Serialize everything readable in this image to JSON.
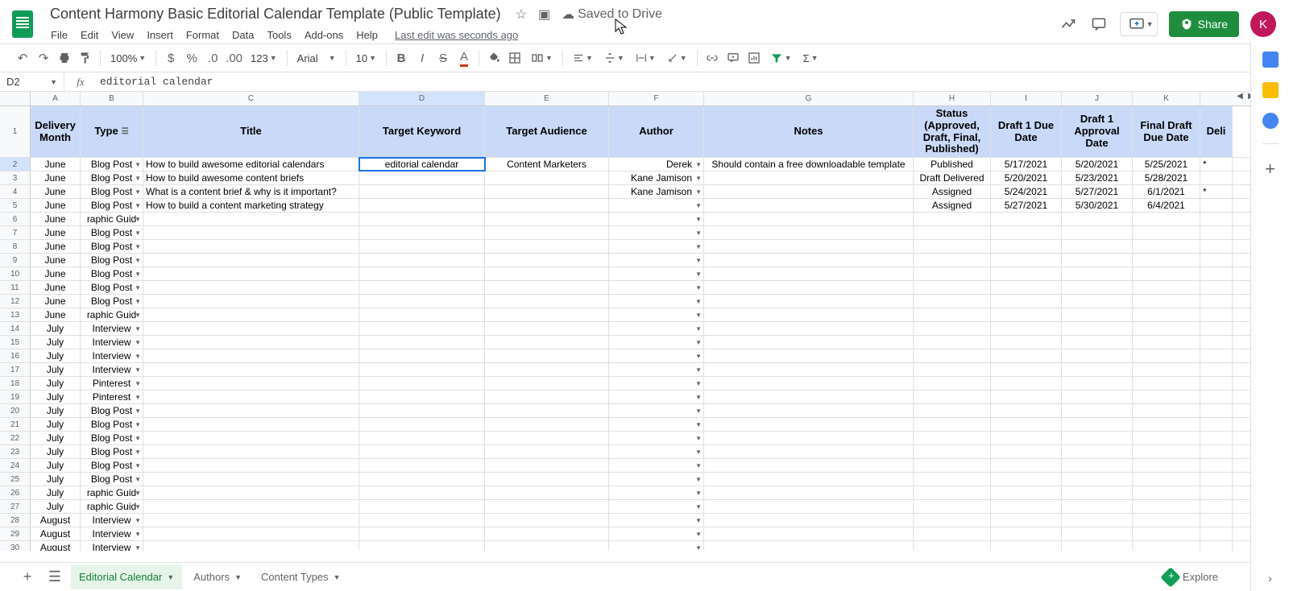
{
  "doc_title": "Content Harmony Basic Editorial Calendar Template (Public Template)",
  "saved_text": "Saved to Drive",
  "menus": [
    "File",
    "Edit",
    "View",
    "Insert",
    "Format",
    "Data",
    "Tools",
    "Add-ons",
    "Help"
  ],
  "last_edit": "Last edit was seconds ago",
  "share_label": "Share",
  "avatar_letter": "K",
  "toolbar": {
    "zoom": "100%",
    "num_fmt": "123",
    "font": "Arial",
    "font_size": "10"
  },
  "name_box": "D2",
  "formula": "editorial calendar",
  "col_letters": [
    "A",
    "B",
    "C",
    "D",
    "E",
    "F",
    "G",
    "H",
    "I",
    "J",
    "K"
  ],
  "headers": [
    "Delivery Month",
    "Type",
    "Title",
    "Target Keyword",
    "Target Audience",
    "Author",
    "Notes",
    "Status (Approved, Draft, Final, Published)",
    "Draft 1 Due Date",
    "Draft 1 Approval Date",
    "Final Draft Due Date",
    "Deli"
  ],
  "rows": [
    {
      "n": 2,
      "a": "June",
      "b": "Blog Post",
      "c": "How to build awesome editorial calendars",
      "d": "editorial calendar",
      "e": "Content Marketers",
      "f": "Derek",
      "g": "Should contain a free downloadable template",
      "h": "Published",
      "i": "5/17/2021",
      "j": "5/20/2021",
      "k": "5/25/2021",
      "l": "*"
    },
    {
      "n": 3,
      "a": "June",
      "b": "Blog Post",
      "c": "How to build awesome content briefs",
      "d": "",
      "e": "",
      "f": "Kane Jamison",
      "g": "",
      "h": "Draft Delivered",
      "i": "5/20/2021",
      "j": "5/23/2021",
      "k": "5/28/2021",
      "l": ""
    },
    {
      "n": 4,
      "a": "June",
      "b": "Blog Post",
      "c": "What is a content brief & why is it important?",
      "d": "",
      "e": "",
      "f": "Kane Jamison",
      "g": "",
      "h": "Assigned",
      "i": "5/24/2021",
      "j": "5/27/2021",
      "k": "6/1/2021",
      "l": "*"
    },
    {
      "n": 5,
      "a": "June",
      "b": "Blog Post",
      "c": "How to build a content marketing strategy",
      "d": "",
      "e": "",
      "f": "",
      "g": "",
      "h": "Assigned",
      "i": "5/27/2021",
      "j": "5/30/2021",
      "k": "6/4/2021",
      "l": ""
    },
    {
      "n": 6,
      "a": "June",
      "b": "raphic Guid",
      "c": "",
      "d": "",
      "e": "",
      "f": "",
      "g": "",
      "h": "",
      "i": "",
      "j": "",
      "k": "",
      "l": ""
    },
    {
      "n": 7,
      "a": "June",
      "b": "Blog Post",
      "c": "",
      "d": "",
      "e": "",
      "f": "",
      "g": "",
      "h": "",
      "i": "",
      "j": "",
      "k": "",
      "l": ""
    },
    {
      "n": 8,
      "a": "June",
      "b": "Blog Post",
      "c": "",
      "d": "",
      "e": "",
      "f": "",
      "g": "",
      "h": "",
      "i": "",
      "j": "",
      "k": "",
      "l": ""
    },
    {
      "n": 9,
      "a": "June",
      "b": "Blog Post",
      "c": "",
      "d": "",
      "e": "",
      "f": "",
      "g": "",
      "h": "",
      "i": "",
      "j": "",
      "k": "",
      "l": ""
    },
    {
      "n": 10,
      "a": "June",
      "b": "Blog Post",
      "c": "",
      "d": "",
      "e": "",
      "f": "",
      "g": "",
      "h": "",
      "i": "",
      "j": "",
      "k": "",
      "l": ""
    },
    {
      "n": 11,
      "a": "June",
      "b": "Blog Post",
      "c": "",
      "d": "",
      "e": "",
      "f": "",
      "g": "",
      "h": "",
      "i": "",
      "j": "",
      "k": "",
      "l": ""
    },
    {
      "n": 12,
      "a": "June",
      "b": "Blog Post",
      "c": "",
      "d": "",
      "e": "",
      "f": "",
      "g": "",
      "h": "",
      "i": "",
      "j": "",
      "k": "",
      "l": ""
    },
    {
      "n": 13,
      "a": "June",
      "b": "raphic Guid",
      "c": "",
      "d": "",
      "e": "",
      "f": "",
      "g": "",
      "h": "",
      "i": "",
      "j": "",
      "k": "",
      "l": ""
    },
    {
      "n": 14,
      "a": "July",
      "b": "Interview",
      "c": "",
      "d": "",
      "e": "",
      "f": "",
      "g": "",
      "h": "",
      "i": "",
      "j": "",
      "k": "",
      "l": ""
    },
    {
      "n": 15,
      "a": "July",
      "b": "Interview",
      "c": "",
      "d": "",
      "e": "",
      "f": "",
      "g": "",
      "h": "",
      "i": "",
      "j": "",
      "k": "",
      "l": ""
    },
    {
      "n": 16,
      "a": "July",
      "b": "Interview",
      "c": "",
      "d": "",
      "e": "",
      "f": "",
      "g": "",
      "h": "",
      "i": "",
      "j": "",
      "k": "",
      "l": ""
    },
    {
      "n": 17,
      "a": "July",
      "b": "Interview",
      "c": "",
      "d": "",
      "e": "",
      "f": "",
      "g": "",
      "h": "",
      "i": "",
      "j": "",
      "k": "",
      "l": ""
    },
    {
      "n": 18,
      "a": "July",
      "b": "Pinterest",
      "c": "",
      "d": "",
      "e": "",
      "f": "",
      "g": "",
      "h": "",
      "i": "",
      "j": "",
      "k": "",
      "l": ""
    },
    {
      "n": 19,
      "a": "July",
      "b": "Pinterest",
      "c": "",
      "d": "",
      "e": "",
      "f": "",
      "g": "",
      "h": "",
      "i": "",
      "j": "",
      "k": "",
      "l": ""
    },
    {
      "n": 20,
      "a": "July",
      "b": "Blog Post",
      "c": "",
      "d": "",
      "e": "",
      "f": "",
      "g": "",
      "h": "",
      "i": "",
      "j": "",
      "k": "",
      "l": ""
    },
    {
      "n": 21,
      "a": "July",
      "b": "Blog Post",
      "c": "",
      "d": "",
      "e": "",
      "f": "",
      "g": "",
      "h": "",
      "i": "",
      "j": "",
      "k": "",
      "l": ""
    },
    {
      "n": 22,
      "a": "July",
      "b": "Blog Post",
      "c": "",
      "d": "",
      "e": "",
      "f": "",
      "g": "",
      "h": "",
      "i": "",
      "j": "",
      "k": "",
      "l": ""
    },
    {
      "n": 23,
      "a": "July",
      "b": "Blog Post",
      "c": "",
      "d": "",
      "e": "",
      "f": "",
      "g": "",
      "h": "",
      "i": "",
      "j": "",
      "k": "",
      "l": ""
    },
    {
      "n": 24,
      "a": "July",
      "b": "Blog Post",
      "c": "",
      "d": "",
      "e": "",
      "f": "",
      "g": "",
      "h": "",
      "i": "",
      "j": "",
      "k": "",
      "l": ""
    },
    {
      "n": 25,
      "a": "July",
      "b": "Blog Post",
      "c": "",
      "d": "",
      "e": "",
      "f": "",
      "g": "",
      "h": "",
      "i": "",
      "j": "",
      "k": "",
      "l": ""
    },
    {
      "n": 26,
      "a": "July",
      "b": "raphic Guid",
      "c": "",
      "d": "",
      "e": "",
      "f": "",
      "g": "",
      "h": "",
      "i": "",
      "j": "",
      "k": "",
      "l": ""
    },
    {
      "n": 27,
      "a": "July",
      "b": "raphic Guid",
      "c": "",
      "d": "",
      "e": "",
      "f": "",
      "g": "",
      "h": "",
      "i": "",
      "j": "",
      "k": "",
      "l": ""
    },
    {
      "n": 28,
      "a": "August",
      "b": "Interview",
      "c": "",
      "d": "",
      "e": "",
      "f": "",
      "g": "",
      "h": "",
      "i": "",
      "j": "",
      "k": "",
      "l": ""
    },
    {
      "n": 29,
      "a": "August",
      "b": "Interview",
      "c": "",
      "d": "",
      "e": "",
      "f": "",
      "g": "",
      "h": "",
      "i": "",
      "j": "",
      "k": "",
      "l": ""
    },
    {
      "n": 30,
      "a": "August",
      "b": "Interview",
      "c": "",
      "d": "",
      "e": "",
      "f": "",
      "g": "",
      "h": "",
      "i": "",
      "j": "",
      "k": "",
      "l": ""
    }
  ],
  "sheet_tabs": [
    {
      "label": "Editorial Calendar",
      "active": true
    },
    {
      "label": "Authors",
      "active": false
    },
    {
      "label": "Content Types",
      "active": false
    }
  ],
  "explore_label": "Explore"
}
